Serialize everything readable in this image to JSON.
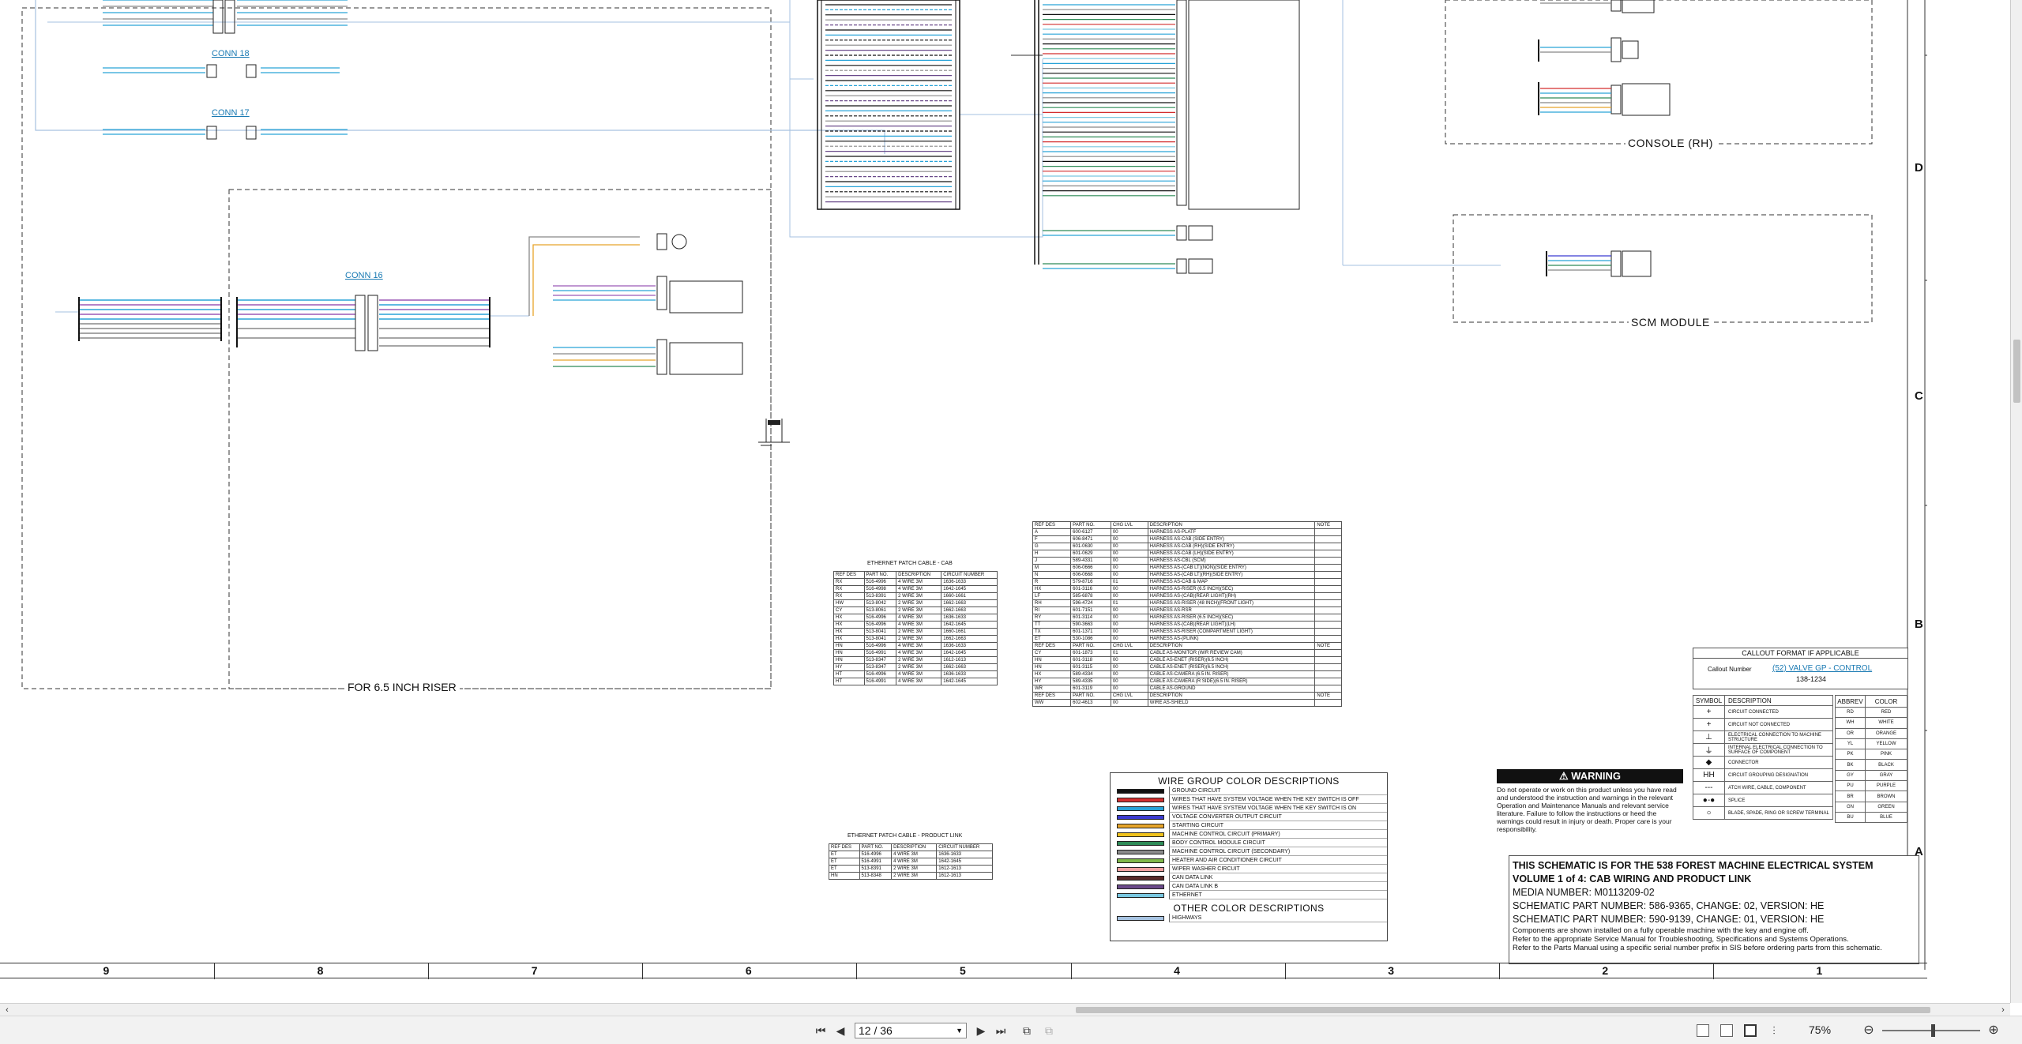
{
  "sheet": {
    "conn18": "CONN 18",
    "conn17": "CONN 17",
    "conn16": "CONN 16",
    "console_rh": "CONSOLE (RH)",
    "scm_module": "SCM MODULE",
    "riser": "FOR 6.5 INCH RISER",
    "grid_letters": [
      "D",
      "C",
      "B",
      "A"
    ],
    "grid_numbers": [
      "9",
      "8",
      "7",
      "6",
      "5",
      "4",
      "3",
      "2",
      "1"
    ]
  },
  "patch_cab": {
    "title": "ETHERNET PATCH CABLE - CAB",
    "headers": [
      "REF DES",
      "PART NO.",
      "DESCRIPTION",
      "CIRCUIT NUMBER"
    ],
    "rows": [
      [
        "RX",
        "516-4996",
        "4 WIRE 3M",
        "1636-1633"
      ],
      [
        "RX",
        "516-4998",
        "4 WIRE 3M",
        "1642-1645"
      ],
      [
        "RX",
        "513-8391",
        "2 WIRE 3M",
        "1660-1661"
      ],
      [
        "HW",
        "513-8042",
        "2 WIRE 3M",
        "1662-1663"
      ],
      [
        "CY",
        "513-8061",
        "2 WIRE 3M",
        "1662-1663"
      ],
      [
        "HX",
        "516-4996",
        "4 WIRE 3M",
        "1636-1633"
      ],
      [
        "HX",
        "516-4996",
        "4 WIRE 3M",
        "1642-1645"
      ],
      [
        "HX",
        "513-8041",
        "2 WIRE 3M",
        "1660-1661"
      ],
      [
        "HX",
        "513-8041",
        "2 WIRE 3M",
        "1662-1663"
      ],
      [
        "HN",
        "516-4996",
        "4 WIRE 3M",
        "1636-1633"
      ],
      [
        "HN",
        "516-4991",
        "4 WIRE 3M",
        "1642-1645"
      ],
      [
        "HN",
        "513-8347",
        "2 WIRE 3M",
        "1612-1613"
      ],
      [
        "HY",
        "513-8347",
        "2 WIRE 3M",
        "1662-1663"
      ],
      [
        "HT",
        "516-4996",
        "4 WIRE 3M",
        "1636-1633"
      ],
      [
        "HT",
        "516-4991",
        "4 WIRE 3M",
        "1642-1645"
      ]
    ]
  },
  "patch_plink": {
    "title": "ETHERNET PATCH CABLE - PRODUCT LINK",
    "headers": [
      "REF DES",
      "PART NO.",
      "DESCRIPTION",
      "CIRCUIT NUMBER"
    ],
    "rows": [
      [
        "ET",
        "516-4996",
        "4 WIRE 3M",
        "1636-1633"
      ],
      [
        "ET",
        "516-4991",
        "4 WIRE 3M",
        "1642-1645"
      ],
      [
        "ET",
        "513-8391",
        "2 WIRE 3M",
        "1612-1613"
      ],
      [
        "HN",
        "513-8348",
        "2 WIRE 3M",
        "1612-1613"
      ]
    ]
  },
  "harness": {
    "headers": [
      "REF DES",
      "PART NO.",
      "CHG LVL",
      "DESCRIPTION",
      "NOTE"
    ],
    "rows": [
      [
        "A",
        "600-6127",
        "00",
        "HARNESS AS-PLATF",
        ""
      ],
      [
        "F",
        "606-8471",
        "00",
        "HARNESS AS-CAB (SIDE ENTRY)",
        ""
      ],
      [
        "G",
        "601-0630",
        "00",
        "HARNESS AS-CAB (RH)(SIDE ENTRY)",
        ""
      ],
      [
        "H",
        "601-0629",
        "00",
        "HARNESS AS-CAB (LH)(SIDE ENTRY)",
        ""
      ],
      [
        "J",
        "589-4331",
        "00",
        "HARNESS AS-CBL (SCM)",
        ""
      ],
      [
        "M",
        "606-0666",
        "00",
        "HARNESS AS-(CAB LT)(NON)(SIDE ENTRY)",
        ""
      ],
      [
        "N",
        "606-0668",
        "00",
        "HARNESS AS-(CAB LT)(RH)(SIDE ENTRY)",
        ""
      ],
      [
        "R",
        "579-8716",
        "01",
        "HARNESS AS-CAB & MAP",
        ""
      ],
      [
        "HX",
        "601-3116",
        "00",
        "HARNESS AS-RISER (6.5 INCH)(SEC)",
        ""
      ],
      [
        "LF",
        "585-6878",
        "00",
        "HARNESS AS-(CAB)(REAR LIGHT)(RH)",
        ""
      ],
      [
        "RH",
        "596-4724",
        "01",
        "HARNESS AS-RISER (48 INCH)(FRONT LIGHT)",
        ""
      ],
      [
        "RI",
        "601-7151",
        "00",
        "HARNESS AS-RSR",
        ""
      ],
      [
        "RY",
        "601-3114",
        "00",
        "HARNESS AS-RISER (6.5 INCH)(SEC)",
        ""
      ],
      [
        "TT",
        "590-3663",
        "00",
        "HARNESS AS-(CAB)(REAR LIGHT)(LH)",
        ""
      ],
      [
        "TX",
        "601-1371",
        "00",
        "HARNESS AS-RISER (COMPARTMENT LIGHT)",
        ""
      ],
      [
        "ET",
        "530-1086",
        "00",
        "HARNESS AS-(PLINK)",
        ""
      ]
    ],
    "cable_rows": [
      [
        "CY",
        "601-1873",
        "01",
        "CABLE AS-MONITOR (W/R REVIEW CAM)",
        ""
      ],
      [
        "HN",
        "601-3118",
        "00",
        "CABLE AS-ENET (RISER)(6.5 INCH)",
        ""
      ],
      [
        "HN",
        "601-3115",
        "00",
        "CABLE AS-ENET (RISER)(6.5 INCH)",
        ""
      ],
      [
        "HX",
        "589-4334",
        "00",
        "CABLE AS-CAMERA (6.5 IN. RISER)",
        ""
      ],
      [
        "HY",
        "589-4335",
        "00",
        "CABLE AS-CAMERA (R SIDE)(6.5 IN. RISER)",
        ""
      ],
      [
        "WR",
        "601-3119",
        "00",
        "CABLE AS-GROUND",
        ""
      ]
    ],
    "wire_rows": [
      [
        "WW",
        "602-4613",
        "00",
        "WIRE AS-SHIELD",
        ""
      ]
    ]
  },
  "wgcd": {
    "title": "WIRE GROUP COLOR DESCRIPTIONS",
    "items": [
      {
        "label": "GROUND CIRCUIT",
        "color": "#111111"
      },
      {
        "label": "WIRES THAT HAVE SYSTEM VOLTAGE WHEN THE KEY SWITCH IS OFF",
        "color": "#d32f2f"
      },
      {
        "label": "WIRES THAT HAVE SYSTEM VOLTAGE WHEN THE KEY SWITCH IS ON",
        "color": "#29a3d8"
      },
      {
        "label": "VOLTAGE CONVERTER OUTPUT CIRCUIT",
        "color": "#3b3bd1"
      },
      {
        "label": "STARTING CIRCUIT",
        "color": "#e7a52a"
      },
      {
        "label": "MACHINE CONTROL CIRCUIT (PRIMARY)",
        "color": "#f0c21c"
      },
      {
        "label": "BODY CONTROL MODULE CIRCUIT",
        "color": "#2e8b57"
      },
      {
        "label": "MACHINE CONTROL CIRCUIT (SECONDARY)",
        "color": "#8a8a8a"
      },
      {
        "label": "HEATER AND AIR CONDITIONER CIRCUIT",
        "color": "#7fb84a"
      },
      {
        "label": "WIPER WASHER CIRCUIT",
        "color": "#f0a0a0"
      },
      {
        "label": "CAN DATA LINK",
        "color": "#5a2a2a"
      },
      {
        "label": "CAN DATA LINK B",
        "color": "#6a4a8a"
      },
      {
        "label": "ETHERNET",
        "color": "#79c7e0"
      }
    ],
    "other_title": "OTHER COLOR DESCRIPTIONS",
    "other_items": [
      {
        "label": "HIGHWAYS",
        "color": "#a6c2e0"
      }
    ]
  },
  "warning": {
    "title": "WARNING",
    "text": "Do not operate or work on this product unless you have read and understood the instruction and warnings in the relevant Operation and Maintenance Manuals and relevant service literature. Failure to follow the instructions or heed the warnings could result in injury or death. Proper care is your responsibility."
  },
  "callout": {
    "title": "CALLOUT FORMAT IF APPLICABLE",
    "label": "Callout Number",
    "example": "(52) VALVE GP - CONTROL",
    "part": "138-1234"
  },
  "symbols": {
    "headers": [
      "SYMBOL",
      "DESCRIPTION"
    ],
    "rows": [
      {
        "sym": "+",
        "desc": "CIRCUIT CONNECTED"
      },
      {
        "sym": "+",
        "desc": "CIRCUIT NOT CONNECTED"
      },
      {
        "sym": "⊥",
        "desc": "ELECTRICAL CONNECTION TO MACHINE STRUCTURE"
      },
      {
        "sym": "⏚",
        "desc": "INTERNAL ELECTRICAL CONNECTION TO SURFACE OF COMPONENT"
      },
      {
        "sym": "◆",
        "desc": "CONNECTOR"
      },
      {
        "sym": "HH",
        "desc": "CIRCUIT GROUPING DESIGNATION"
      },
      {
        "sym": "---",
        "desc": "ATCH WIRE, CABLE, COMPONENT"
      },
      {
        "sym": "●-●",
        "desc": "SPLICE"
      },
      {
        "sym": "○",
        "desc": "BLADE, SPADE, RING OR SCREW TERMINAL"
      }
    ]
  },
  "abbrev": {
    "headers": [
      "ABBREV",
      "COLOR"
    ],
    "rows": [
      [
        "RD",
        "RED"
      ],
      [
        "WH",
        "WHITE"
      ],
      [
        "OR",
        "ORANGE"
      ],
      [
        "YL",
        "YELLOW"
      ],
      [
        "PK",
        "PINK"
      ],
      [
        "BK",
        "BLACK"
      ],
      [
        "GY",
        "GRAY"
      ],
      [
        "PU",
        "PURPLE"
      ],
      [
        "BR",
        "BROWN"
      ],
      [
        "GN",
        "GREEN"
      ],
      [
        "BU",
        "BLUE"
      ]
    ]
  },
  "schematic": {
    "line1": "THIS SCHEMATIC IS FOR THE 538 FOREST MACHINE ELECTRICAL SYSTEM",
    "line2": "VOLUME 1 of 4: CAB WIRING AND PRODUCT LINK",
    "line3": "MEDIA NUMBER: M0113209-02",
    "line4": "SCHEMATIC PART NUMBER: 586-9365, CHANGE: 02, VERSION: HE",
    "line5": "SCHEMATIC PART NUMBER: 590-9139, CHANGE: 01, VERSION: HE",
    "line6": "Components are shown installed on a fully operable machine with the key and engine off.",
    "line7": "Refer to the appropriate Service Manual for Troubleshooting, Specifications and Systems Operations.",
    "line8": "Refer to the Parts Manual using a specific serial number prefix in SIS before ordering parts from this schematic."
  },
  "toolbar": {
    "page": "12 / 36",
    "zoom": "75%"
  },
  "colors": {
    "accent": "#1a7ab3",
    "link": "#1a7ab3"
  }
}
